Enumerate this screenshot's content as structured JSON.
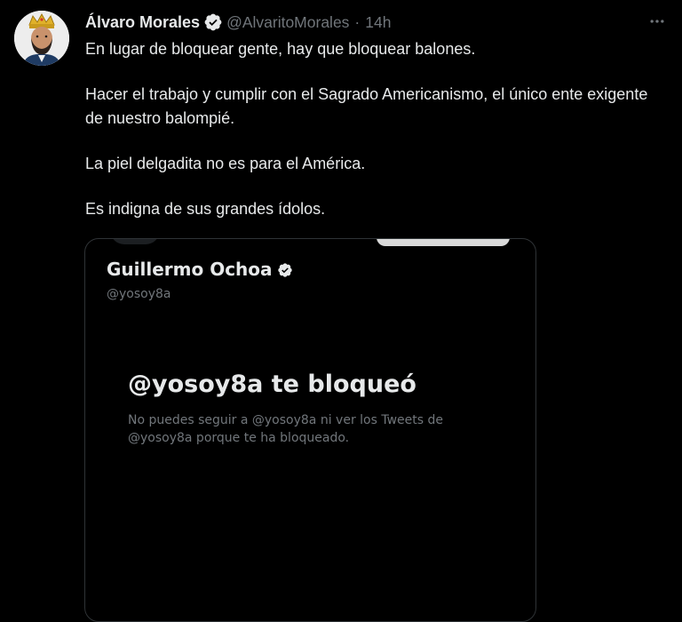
{
  "tweet": {
    "author": {
      "display_name": "Álvaro Morales",
      "handle": "@AlvaritoMorales",
      "separator": "·",
      "time": "14h",
      "verified": true
    },
    "paragraphs": [
      "En lugar de bloquear gente, hay que bloquear balones.",
      "Hacer el trabajo y cumplir con el Sagrado Americanismo, el único ente exigente de nuestro balompié.",
      "La piel delgadita no es para el América.",
      "Es indigna de sus grandes ídolos."
    ],
    "more_icon": "more-horizontal-icon"
  },
  "media": {
    "profile_name": "Guillermo Ochoa",
    "profile_handle": "@yosoy8a",
    "blocked_title": "@yosoy8a te bloqueó",
    "blocked_description": "No puedes seguir a @yosoy8a ni ver los Tweets de @yosoy8a porque te ha bloqueado."
  },
  "colors": {
    "background": "#000000",
    "text_primary": "#e7e9ea",
    "text_secondary": "#71767b",
    "verified_blue": "#1d9bf0",
    "border": "#2f3336"
  }
}
